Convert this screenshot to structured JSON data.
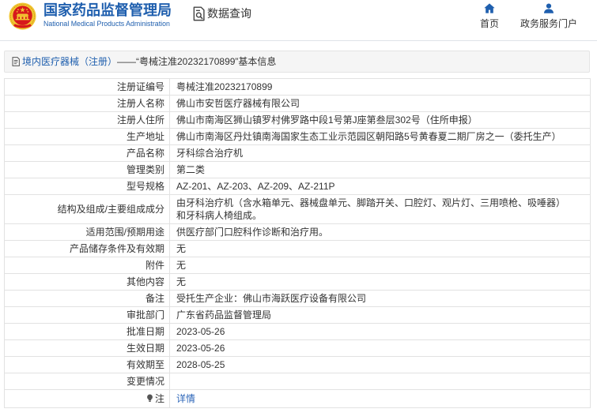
{
  "header": {
    "logo_icon": "national-emblem-logo",
    "org_name_cn": "国家药品监督管理局",
    "org_name_en": "National Medical Products Administration",
    "section_icon": "data-query-icon",
    "section_title": "数据查询",
    "nav": [
      {
        "label": "首页",
        "icon": "home-icon"
      },
      {
        "label": "政务服务门户",
        "icon": "user-icon"
      }
    ]
  },
  "breadcrumb": {
    "icon": "document-icon",
    "category": "境内医疗器械（注册）",
    "separator": "——",
    "record": "“粤械注准20232170899”",
    "suffix": "基本信息"
  },
  "details": {
    "rows": [
      {
        "label": "注册证编号",
        "value": "粤械注准20232170899"
      },
      {
        "label": "注册人名称",
        "value": "佛山市安哲医疗器械有限公司"
      },
      {
        "label": "注册人住所",
        "value": "佛山市南海区狮山镇罗村佛罗路中段1号第J座第叁层302号（住所申报）"
      },
      {
        "label": "生产地址",
        "value": "佛山市南海区丹灶镇南海国家生态工业示范园区朝阳路5号黄春夏二期厂房之一（委托生产）"
      },
      {
        "label": "产品名称",
        "value": "牙科综合治疗机"
      },
      {
        "label": "管理类别",
        "value": "第二类"
      },
      {
        "label": "型号规格",
        "value": "AZ-201、AZ-203、AZ-209、AZ-211P"
      },
      {
        "label": "结构及组成/主要组成成分",
        "value": "由牙科治疗机（含水箱单元、器械盘单元、脚踏开关、口腔灯、观片灯、三用喷枪、吸唾器）和牙科病人椅组成。"
      },
      {
        "label": "适用范围/预期用途",
        "value": "供医疗部门口腔科作诊断和治疗用。"
      },
      {
        "label": "产品储存条件及有效期",
        "value": "无"
      },
      {
        "label": "附件",
        "value": "无"
      },
      {
        "label": "其他内容",
        "value": "无"
      },
      {
        "label": "备注",
        "value": "受托生产企业：佛山市海跃医疗设备有限公司"
      },
      {
        "label": "审批部门",
        "value": "广东省药品监督管理局"
      },
      {
        "label": "批准日期",
        "value": "2023-05-26"
      },
      {
        "label": "生效日期",
        "value": "2023-05-26"
      },
      {
        "label": "有效期至",
        "value": "2028-05-25"
      },
      {
        "label": "变更情况",
        "value": ""
      }
    ],
    "note": {
      "icon": "bulb-icon",
      "label": "注",
      "link_label": "详情"
    }
  },
  "theme": {
    "brand_blue": "#1f5fae",
    "link_blue": "#2b65b8",
    "text": "#333333",
    "border": "#e2e2e2",
    "bar_background": "#f5f5f5",
    "emblem_red": "#d7191c",
    "emblem_gold": "#f2c631"
  }
}
